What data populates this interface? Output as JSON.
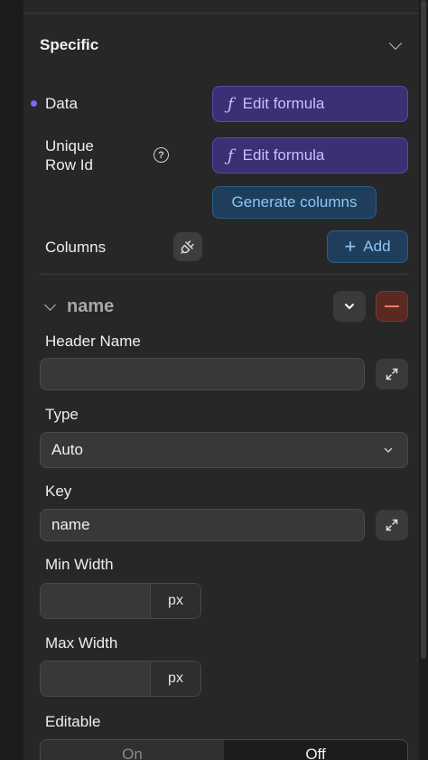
{
  "panel": {
    "section_title": "Specific"
  },
  "fields": {
    "data_label": "Data",
    "unique_row_label": "Unique Row Id",
    "formula_button": "Edit formula",
    "formula_icon": "ƒ",
    "generate_columns": "Generate columns",
    "columns_label": "Columns",
    "add_button": "Add",
    "add_icon": "+"
  },
  "column": {
    "name": "name",
    "header_name_label": "Header Name",
    "header_name_value": "",
    "type_label": "Type",
    "type_value": "Auto",
    "key_label": "Key",
    "key_value": "name",
    "min_width_label": "Min Width",
    "min_width_value": "",
    "max_width_label": "Max Width",
    "max_width_value": "",
    "unit": "px",
    "editable_label": "Editable",
    "editable_options": [
      "On",
      "Off"
    ],
    "editable_selected": "Off"
  },
  "colors": {
    "accent_purple": "#3c2f73",
    "accent_blue": "#1e3e5c",
    "danger": "#6a2a22"
  }
}
